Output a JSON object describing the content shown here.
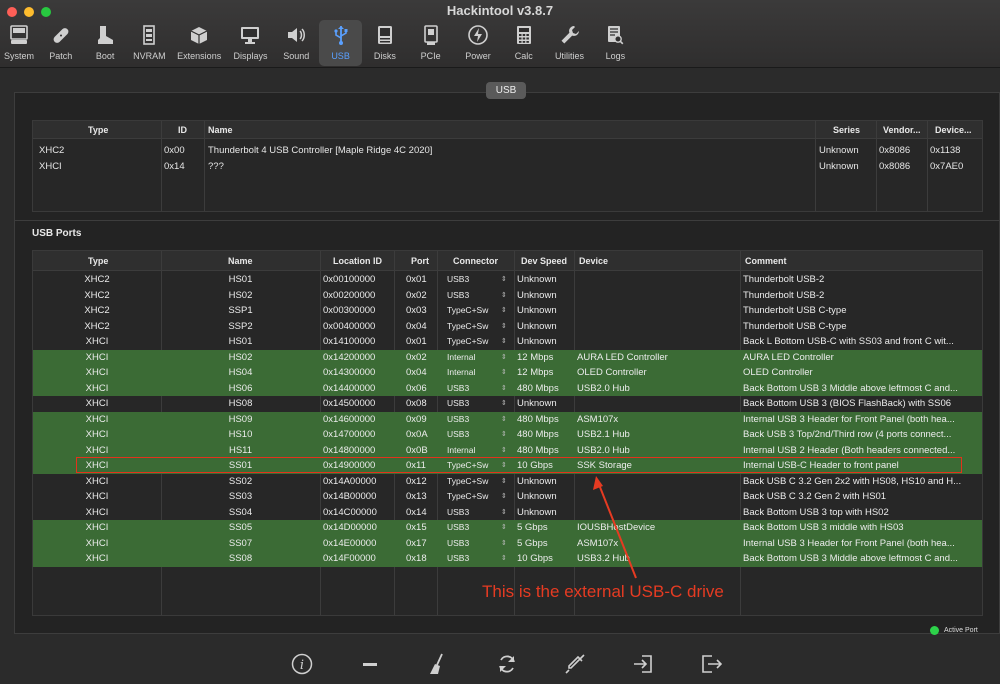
{
  "window": {
    "title": "Hackintool v3.8.7"
  },
  "toolbar": {
    "items": [
      {
        "label": "System",
        "icon": "computer-icon"
      },
      {
        "label": "Patch",
        "icon": "bandage-icon"
      },
      {
        "label": "Boot",
        "icon": "boot-icon"
      },
      {
        "label": "NVRAM",
        "icon": "memory-chip-icon"
      },
      {
        "label": "Extensions",
        "icon": "box-icon"
      },
      {
        "label": "Displays",
        "icon": "monitor-icon"
      },
      {
        "label": "Sound",
        "icon": "speaker-icon"
      },
      {
        "label": "USB",
        "icon": "usb-icon",
        "active": true
      },
      {
        "label": "Disks",
        "icon": "disk-icon"
      },
      {
        "label": "PCIe",
        "icon": "pcie-icon"
      },
      {
        "label": "Power",
        "icon": "power-bolt-icon"
      },
      {
        "label": "Calc",
        "icon": "calculator-icon"
      },
      {
        "label": "Utilities",
        "icon": "wrench-icon"
      },
      {
        "label": "Logs",
        "icon": "log-icon"
      }
    ]
  },
  "tab": {
    "label": "USB"
  },
  "controllers": {
    "headers": {
      "type": "Type",
      "id": "ID",
      "name": "Name",
      "series": "Series",
      "vendor": "Vendor...",
      "device": "Device..."
    },
    "rows": [
      {
        "type": "XHC2",
        "id": "0x00",
        "name": "Thunderbolt 4 USB Controller [Maple Ridge 4C 2020]",
        "series": "Unknown",
        "vendor": "0x8086",
        "device": "0x1138"
      },
      {
        "type": "XHCI",
        "id": "0x14",
        "name": "???",
        "series": "Unknown",
        "vendor": "0x8086",
        "device": "0x7AE0"
      }
    ]
  },
  "ports": {
    "section_title": "USB Ports",
    "headers": {
      "type": "Type",
      "name": "Name",
      "location": "Location ID",
      "port": "Port",
      "connector": "Connector",
      "speed": "Dev Speed",
      "device": "Device",
      "comment": "Comment"
    },
    "rows": [
      {
        "type": "XHC2",
        "name": "HS01",
        "location": "0x00100000",
        "port": "0x01",
        "connector": "USB3",
        "speed": "Unknown",
        "device": "",
        "comment": "Thunderbolt USB-2",
        "active": false
      },
      {
        "type": "XHC2",
        "name": "HS02",
        "location": "0x00200000",
        "port": "0x02",
        "connector": "USB3",
        "speed": "Unknown",
        "device": "",
        "comment": "Thunderbolt USB-2",
        "active": false
      },
      {
        "type": "XHC2",
        "name": "SSP1",
        "location": "0x00300000",
        "port": "0x03",
        "connector": "TypeC+Sw",
        "speed": "Unknown",
        "device": "",
        "comment": "Thunderbolt USB C-type",
        "active": false
      },
      {
        "type": "XHC2",
        "name": "SSP2",
        "location": "0x00400000",
        "port": "0x04",
        "connector": "TypeC+Sw",
        "speed": "Unknown",
        "device": "",
        "comment": "Thunderbolt USB C-type",
        "active": false
      },
      {
        "type": "XHCI",
        "name": "HS01",
        "location": "0x14100000",
        "port": "0x01",
        "connector": "TypeC+Sw",
        "speed": "Unknown",
        "device": "",
        "comment": "Back L Bottom USB-C with SS03 and front C wit...",
        "active": false
      },
      {
        "type": "XHCI",
        "name": "HS02",
        "location": "0x14200000",
        "port": "0x02",
        "connector": "Internal",
        "speed": "12 Mbps",
        "device": "AURA LED Controller",
        "comment": "AURA LED Controller",
        "active": true
      },
      {
        "type": "XHCI",
        "name": "HS04",
        "location": "0x14300000",
        "port": "0x04",
        "connector": "Internal",
        "speed": "12 Mbps",
        "device": "OLED Controller",
        "comment": "OLED Controller",
        "active": true
      },
      {
        "type": "XHCI",
        "name": "HS06",
        "location": "0x14400000",
        "port": "0x06",
        "connector": "USB3",
        "speed": "480 Mbps",
        "device": "USB2.0 Hub",
        "comment": "Back Bottom USB 3 Middle above leftmost C and...",
        "active": true
      },
      {
        "type": "XHCI",
        "name": "HS08",
        "location": "0x14500000",
        "port": "0x08",
        "connector": "USB3",
        "speed": "Unknown",
        "device": "",
        "comment": "Back Bottom USB 3 (BIOS FlashBack) with SS06",
        "active": false
      },
      {
        "type": "XHCI",
        "name": "HS09",
        "location": "0x14600000",
        "port": "0x09",
        "connector": "USB3",
        "speed": "480 Mbps",
        "device": "ASM107x",
        "comment": "Internal USB 3 Header  for Front Panel (both hea...",
        "active": true
      },
      {
        "type": "XHCI",
        "name": "HS10",
        "location": "0x14700000",
        "port": "0x0A",
        "connector": "USB3",
        "speed": "480 Mbps",
        "device": "USB2.1 Hub",
        "comment": "Back USB 3 Top/2nd/Third row (4 ports connect...",
        "active": true
      },
      {
        "type": "XHCI",
        "name": "HS11",
        "location": "0x14800000",
        "port": "0x0B",
        "connector": "Internal",
        "speed": "480 Mbps",
        "device": "USB2.0 Hub",
        "comment": "Internal USB 2 Header (Both headers connected...",
        "active": true
      },
      {
        "type": "XHCI",
        "name": "SS01",
        "location": "0x14900000",
        "port": "0x11",
        "connector": "TypeC+Sw",
        "speed": "10 Gbps",
        "device": "SSK Storage",
        "comment": "Internal USB-C Header to front panel",
        "active": true
      },
      {
        "type": "XHCI",
        "name": "SS02",
        "location": "0x14A00000",
        "port": "0x12",
        "connector": "TypeC+Sw",
        "speed": "Unknown",
        "device": "",
        "comment": "Back USB C 3.2 Gen 2x2 with HS08, HS10 and H...",
        "active": false
      },
      {
        "type": "XHCI",
        "name": "SS03",
        "location": "0x14B00000",
        "port": "0x13",
        "connector": "TypeC+Sw",
        "speed": "Unknown",
        "device": "",
        "comment": "Back USB C 3.2 Gen 2 with HS01",
        "active": false
      },
      {
        "type": "XHCI",
        "name": "SS04",
        "location": "0x14C00000",
        "port": "0x14",
        "connector": "USB3",
        "speed": "Unknown",
        "device": "",
        "comment": "Back Bottom USB 3 top with HS02",
        "active": false
      },
      {
        "type": "XHCI",
        "name": "SS05",
        "location": "0x14D00000",
        "port": "0x15",
        "connector": "USB3",
        "speed": "5 Gbps",
        "device": "IOUSBHostDevice",
        "comment": "Back Bottom USB 3 middle with HS03",
        "active": true
      },
      {
        "type": "XHCI",
        "name": "SS07",
        "location": "0x14E00000",
        "port": "0x17",
        "connector": "USB3",
        "speed": "5 Gbps",
        "device": "ASM107x",
        "comment": "Internal USB 3 Header  for Front Panel (both hea...",
        "active": true
      },
      {
        "type": "XHCI",
        "name": "SS08",
        "location": "0x14F00000",
        "port": "0x18",
        "connector": "USB3",
        "speed": "10 Gbps",
        "device": "USB3.2 Hub",
        "comment": "Back Bottom USB 3 Middle above leftmost C and...",
        "active": true
      }
    ]
  },
  "annotation": {
    "text": "This is the external USB-C drive",
    "color": "#e63b22"
  },
  "legend": {
    "active_port": "Active Port"
  },
  "bottom_toolbar": {
    "items": [
      "info-icon",
      "remove-icon",
      "broom-icon",
      "refresh-icon",
      "inject-icon",
      "import-icon",
      "export-icon"
    ]
  }
}
